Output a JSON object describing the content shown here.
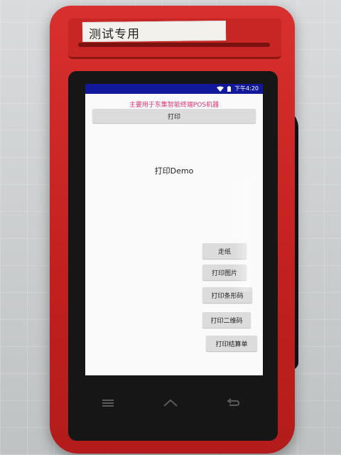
{
  "device": {
    "sticker_text": "测试专用"
  },
  "status_bar": {
    "time": "下午4:20"
  },
  "app": {
    "subtitle": "主要用于东集智能终端POS机器",
    "print_button": "打印",
    "demo_title": "打印Demo",
    "buttons": {
      "feed": "走纸",
      "print_image": "打印图片",
      "print_barcode": "打印条形码",
      "print_qrcode": "打印二维码",
      "print_receipt": "打印结算单"
    }
  },
  "nav": {
    "icons": [
      "menu-icon",
      "home-icon",
      "back-icon"
    ]
  },
  "colors": {
    "status_bar": "#11199a",
    "subtitle": "#e5336f",
    "device_body": "#c2201f"
  }
}
